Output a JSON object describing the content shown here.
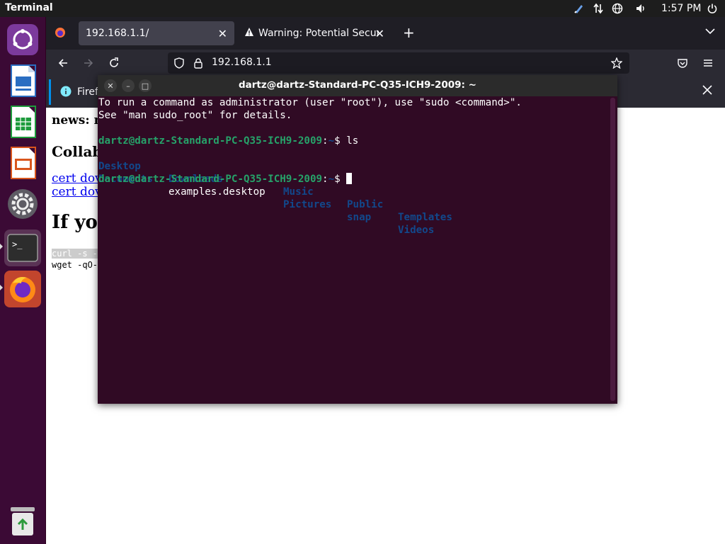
{
  "topbar": {
    "app_name": "Terminal",
    "clock": "1:57 PM"
  },
  "dock": {
    "items": [
      "ubuntu-software",
      "libreoffice-writer",
      "libreoffice-calc",
      "libreoffice-impress",
      "settings",
      "terminal",
      "firefox",
      "trash"
    ]
  },
  "firefox": {
    "tabs": [
      {
        "label": "192.168.1.1/",
        "active": true
      },
      {
        "label": "Warning: Potential Securi",
        "active": false
      }
    ],
    "new_tab": "+",
    "url": "192.168.1.1",
    "notice_text": "Firef",
    "content": {
      "news": "news: m",
      "collab": "Collab",
      "cert_link_1": "cert dov",
      "cert_link_2": "cert dov",
      "if_heading": "If you",
      "code_line_1": "curl -s -",
      "code_line_2": "wget -qO-"
    }
  },
  "terminal": {
    "title": "dartz@dartz-Standard-PC-Q35-ICH9-2009: ~",
    "intro_line_1": "To run a command as administrator (user \"root\"), use \"sudo <command>\".",
    "intro_line_2": "See \"man sudo_root\" for details.",
    "prompt_user": "dartz@dartz-Standard-PC-Q35-ICH9-2009",
    "prompt_colon": ":",
    "prompt_path": "~",
    "prompt_symbol": "$ ",
    "command": "ls",
    "ls_row_1": [
      "Desktop",
      "Downloads",
      "Music",
      "Public",
      "Templates"
    ],
    "ls_row_2": [
      "Documents",
      "examples.desktop",
      "Pictures",
      "snap",
      "Videos"
    ]
  }
}
